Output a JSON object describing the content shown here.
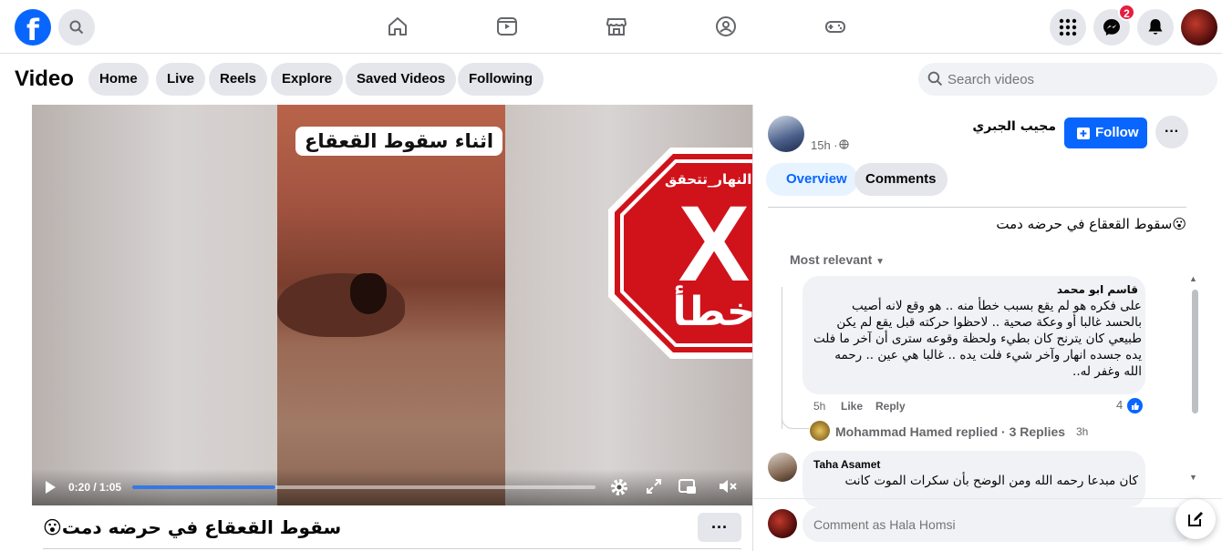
{
  "topnav": {
    "logo": "f",
    "messenger_badge": "2",
    "icons": [
      "search-icon",
      "home-icon",
      "video-icon",
      "marketplace-icon",
      "groups-icon",
      "gaming-icon",
      "menu-grid-icon",
      "messenger-icon",
      "bell-icon"
    ]
  },
  "subbar": {
    "title": "Video",
    "pills": [
      "Home",
      "Live",
      "Reels",
      "Explore",
      "Saved Videos",
      "Following"
    ],
    "search_placeholder": "Search videos"
  },
  "video": {
    "caption": "اثناء سقوط القعقاع",
    "current_time": "0:20",
    "duration": "1:05",
    "time_label": "0:20 / 1:05",
    "progress": 0.31
  },
  "stamp": {
    "hashtag": "#النهار_تتحقق",
    "mark": "X",
    "verdict": "خطأ",
    "color": "#d0121b"
  },
  "below_video": {
    "title": "سقوط القعقاع في حرضه دمت😮",
    "more": "···"
  },
  "panel": {
    "author": "مجيب الجبري",
    "time": "15h ·",
    "follow_label": "Follow",
    "more": "···",
    "tab_overview": "Overview",
    "tab_comments": "Comments",
    "description": "😮سقوط القعقاع في حرضه دمت",
    "sort_label": "Most relevant",
    "comments": [
      {
        "author": "قاسم ابو محمد",
        "text": "على فكره هو لم يقع بسبب خطأ منه .. هو وقع لانه أصيب بالحسد غالبا أو وعكة صحية .. لاحظوا حركته قبل يقع لم يكن طبيعي كان يترنح كان بطيء ولحظة وقوعه سترى أن آخر ما فلت يده جسده انهار وآخر شيء فلت يده .. غالبا هي عين .. رحمه الله وغفر له..",
        "time": "5h",
        "like": "Like",
        "reply": "Reply",
        "likes": "4",
        "replies_text": "Mohammad Hamed replied · 3 Replies",
        "replies_time": "3h"
      },
      {
        "author": "Taha Asamet",
        "text": "كان مبدعا رحمه الله ومن الوضح بأن سكرات الموت كانت"
      }
    ],
    "composer_placeholder": "Comment as Hala Homsi"
  }
}
